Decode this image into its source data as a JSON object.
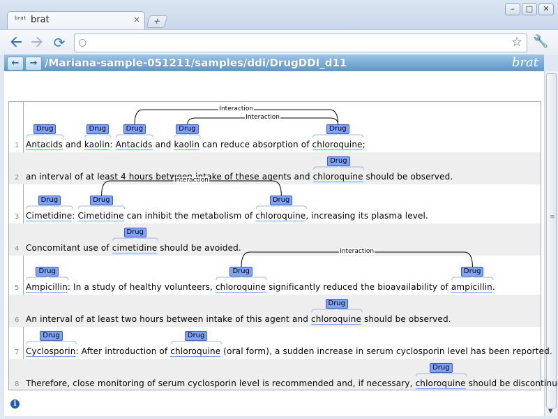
{
  "browser": {
    "tab_title": "brat",
    "tab_icon_text": "brat",
    "tab_close": "×",
    "new_tab": "+",
    "minimize": "–",
    "maximize": "□",
    "close": "✕"
  },
  "header": {
    "doc_path": "/Mariana-sample-051211/samples/ddi/DrugDDI_d11",
    "logo": "brat"
  },
  "entity_label": "Drug",
  "relation_label": "Interaction",
  "sentences": [
    {
      "num": "1",
      "parts": [
        "",
        "Antacids",
        " and ",
        "kaolin",
        ": ",
        "Antacids",
        " and ",
        "kaolin",
        " can reduce absorption of ",
        "chloroquine",
        ";"
      ]
    },
    {
      "num": "2",
      "parts": [
        "an interval of at least 4 hours between intake of these agents and ",
        "chloroquine",
        " should be observed."
      ]
    },
    {
      "num": "3",
      "parts": [
        "",
        "Cimetidine",
        ": ",
        "Cimetidine",
        " can inhibit the metabolism of ",
        "chloroquine",
        ", increasing its plasma level."
      ]
    },
    {
      "num": "4",
      "parts": [
        "Concomitant use of ",
        "cimetidine",
        " should be avoided."
      ]
    },
    {
      "num": "5",
      "parts": [
        "",
        "Ampicillin",
        ": In a study of healthy volunteers, ",
        "chloroquine",
        " significantly reduced the bioavailability of ",
        "ampicillin",
        "."
      ]
    },
    {
      "num": "6",
      "parts": [
        "An interval of at least two hours between intake of this agent and ",
        "chloroquine",
        " should be observed."
      ]
    },
    {
      "num": "7",
      "parts": [
        "",
        "Cyclosporin",
        ": After introduction of ",
        "chloroquine",
        " (oral form), a sudden increase in serum cyclosporin level has been reported."
      ]
    },
    {
      "num": "8",
      "parts": [
        "Therefore, close monitoring of serum cyclosporin level is recommended and, if necessary, ",
        "chloroquine",
        " should be discontinued."
      ]
    }
  ],
  "colors": {
    "entity": "#7fa2ff",
    "header": "#5e97c9",
    "alt_row": "#eeeeee"
  }
}
